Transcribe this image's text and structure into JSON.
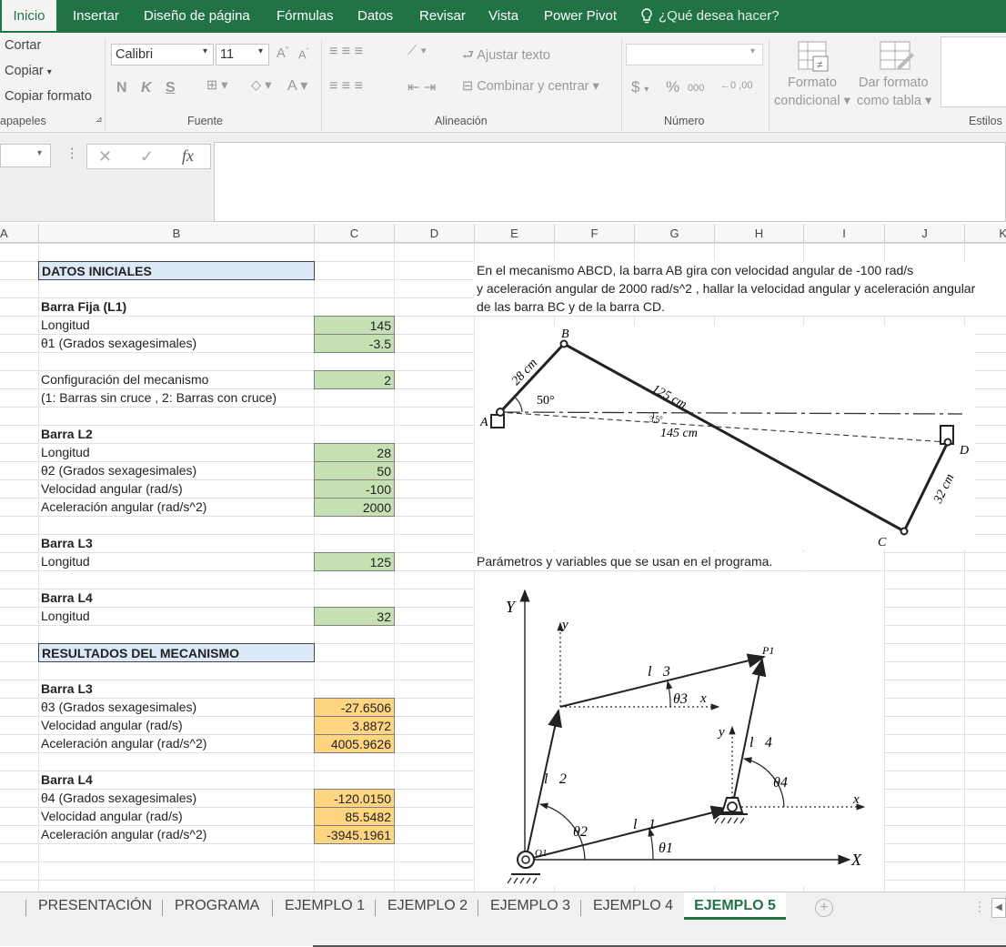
{
  "ribbon_tabs": [
    "Inicio",
    "Insertar",
    "Diseño de página",
    "Fórmulas",
    "Datos",
    "Revisar",
    "Vista",
    "Power Pivot",
    "¿Qué desea hacer?"
  ],
  "clipboard": {
    "cut": "Cortar",
    "copy": "Copiar",
    "format_painter": "Copiar formato",
    "group": "apapeles"
  },
  "font": {
    "name": "Calibri",
    "size": "11",
    "bold": "N",
    "italic": "K",
    "underline": "S",
    "group": "Fuente"
  },
  "alignment": {
    "wrap": "Ajustar texto",
    "merge": "Combinar y centrar",
    "group": "Alineación"
  },
  "number": {
    "currency": "$",
    "percent": "%",
    "thousands": "000",
    "group": "Número"
  },
  "styles": {
    "conditional": "Formato",
    "conditional2": "condicional",
    "table": "Dar formato",
    "table2": "como tabla",
    "group": "Estilos"
  },
  "formula_bar": {
    "fx": "fx",
    "cancel": "✕",
    "confirm": "✓"
  },
  "columns": [
    "A",
    "B",
    "C",
    "D",
    "E",
    "F",
    "G",
    "H",
    "I",
    "J",
    "K"
  ],
  "sheet": {
    "datos_iniciales": "DATOS INICIALES",
    "barra_fija": "Barra Fija (L1)",
    "longitud": "Longitud",
    "theta1": "θ1 (Grados sexagesimales)",
    "config": "Configuración del mecanismo",
    "config_note": "(1: Barras sin cruce , 2: Barras con cruce)",
    "barra_l2": "Barra L2",
    "theta2": "θ2 (Grados sexagesimales)",
    "vel": "Velocidad angular (rad/s)",
    "acc": "Aceleración angular (rad/s^2)",
    "barra_l3": "Barra L3",
    "barra_l4": "Barra L4",
    "resultados": "RESULTADOS DEL MECANISMO",
    "theta3": "θ3 (Grados sexagesimales)",
    "theta4": "θ4 (Grados sexagesimales)",
    "v_l1_long": "145",
    "v_theta1": "-3.5",
    "v_config": "2",
    "v_l2_long": "28",
    "v_theta2": "50",
    "v_l2_vel": "-100",
    "v_l2_acc": "2000",
    "v_l3_long": "125",
    "v_l4_long": "32",
    "r_theta3": "-27.6506",
    "r_vel3": "3.8872",
    "r_acc3": "4005.9626",
    "r_theta4": "-120.0150",
    "r_vel4": "85.5482",
    "r_acc4": "-3945.1961",
    "desc1": "En el mecanismo ABCD, la barra AB gira con velocidad angular de -100 rad/s",
    "desc2": "y aceleración angular de 2000 rad/s^2 , hallar la velocidad angular y aceleración angular",
    "desc3": "de las barra BC y de la barra CD.",
    "params": "Parámetros y variables que se usan en el programa."
  },
  "diagram1": {
    "A": "A",
    "B": "B",
    "C": "C",
    "D": "D",
    "ab": "28 cm",
    "bc": "125 cm",
    "ad": "145 cm",
    "cd": "32 cm",
    "angle": "50°",
    "tilt": "3.5°"
  },
  "diagram2": {
    "Y": "Y",
    "X": "X",
    "y1": "y",
    "y2": "y",
    "x1": "x",
    "x2": "x",
    "l1": "l⃗1",
    "l2": "l⃗2",
    "l3": "l⃗3",
    "l4": "l⃗4",
    "t1": "θ1",
    "t2": "θ2",
    "t3": "θ3",
    "t4": "θ4",
    "P1": "P1",
    "O1": "O1"
  },
  "sheet_tabs": [
    "PRESENTACIÓN",
    "PROGRAMA",
    "EJEMPLO 1",
    "EJEMPLO 2",
    "EJEMPLO 3",
    "EJEMPLO 4",
    "EJEMPLO 5"
  ]
}
